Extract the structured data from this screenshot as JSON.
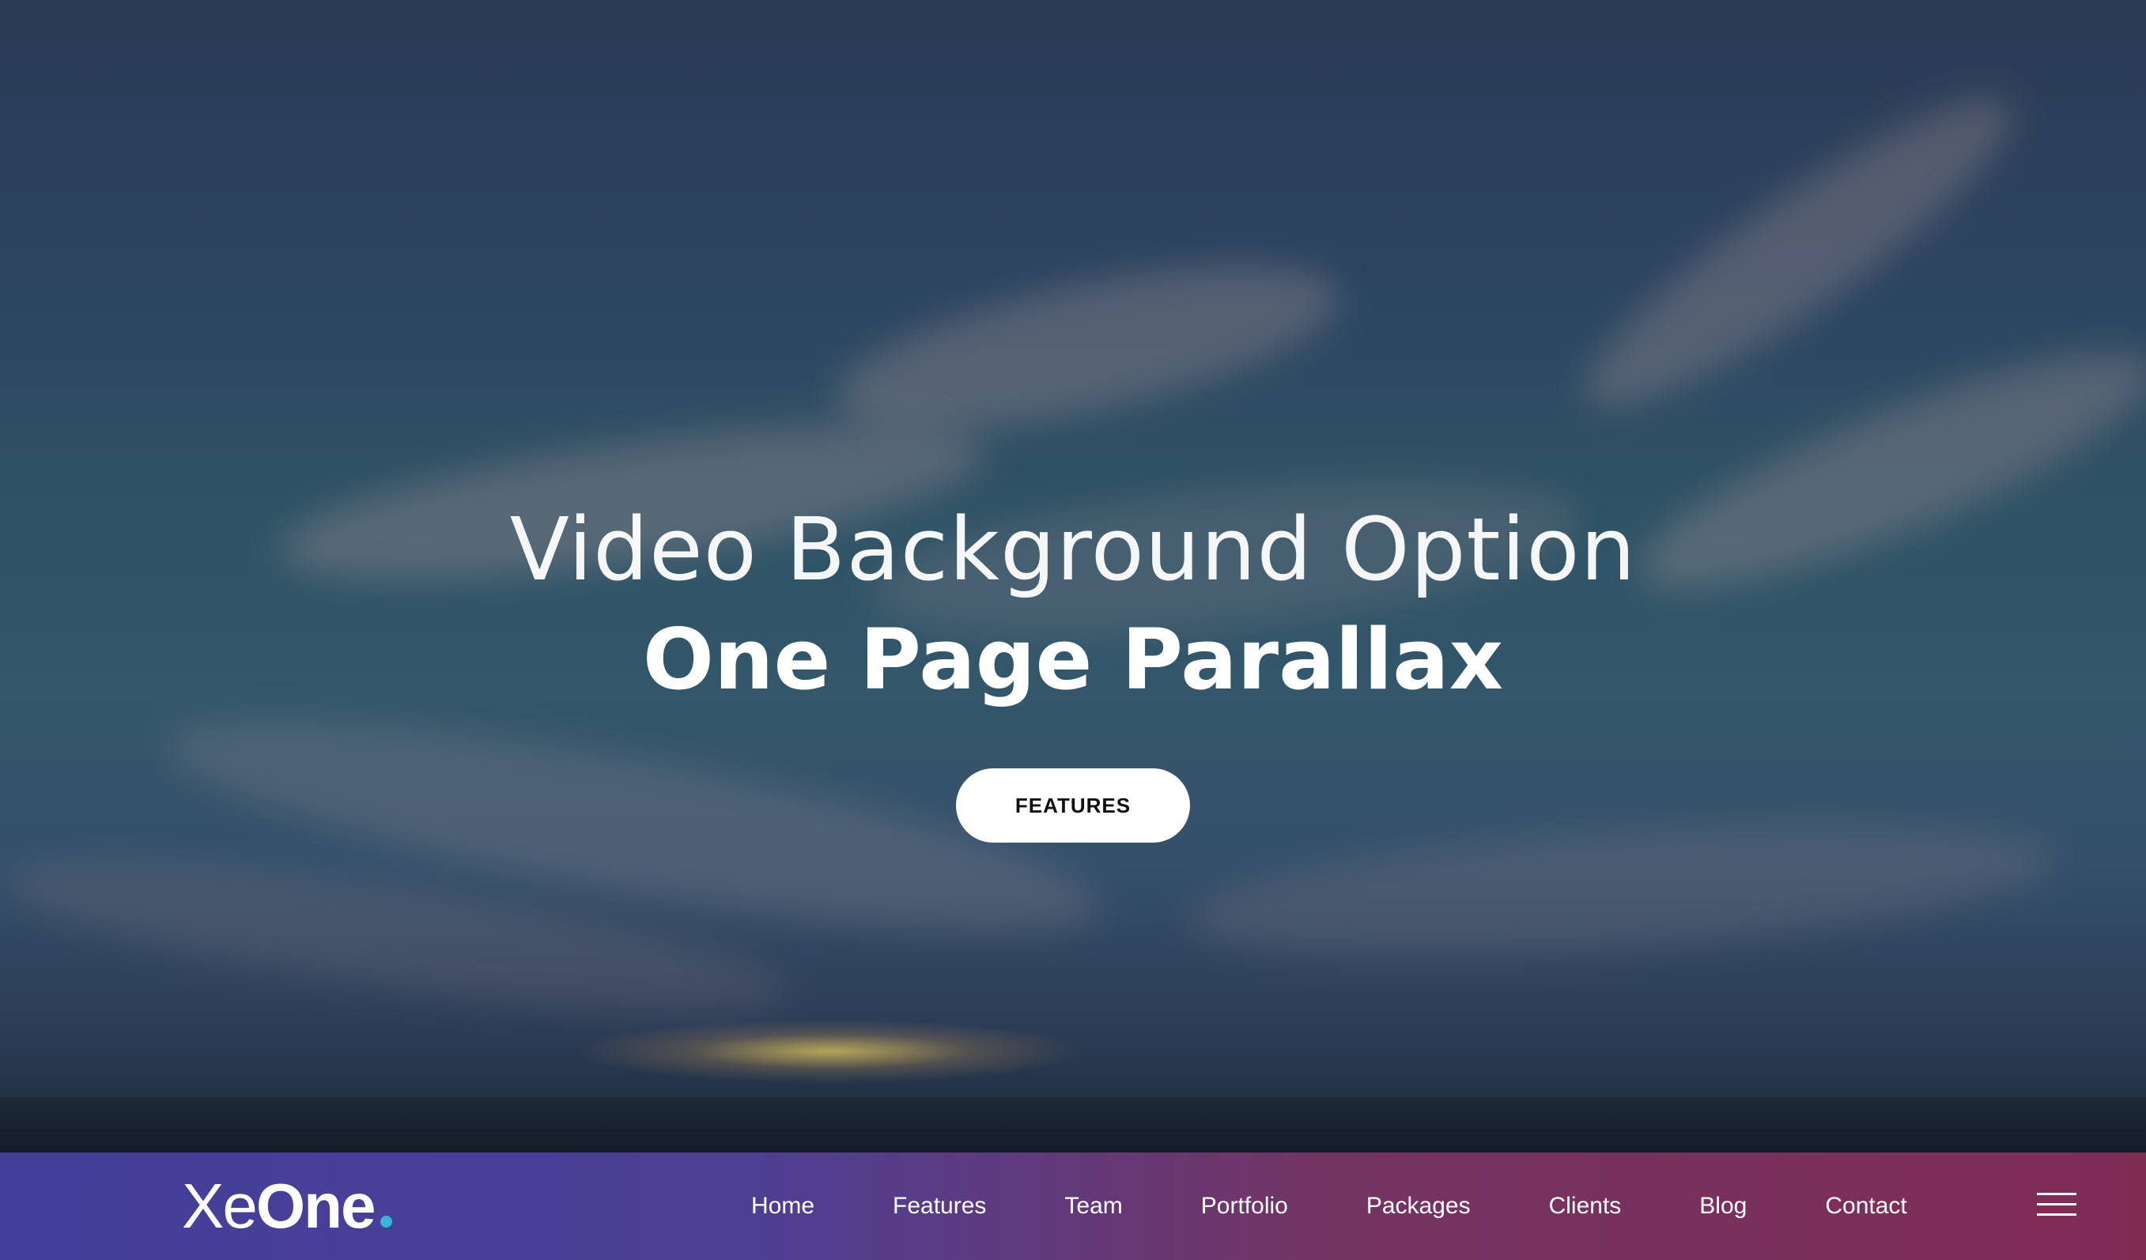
{
  "hero": {
    "subtitle": "Video Background Option",
    "title": "One Page Parallax",
    "cta_label": "FEATURES"
  },
  "navbar": {
    "logo_light": "Xe",
    "logo_bold": "One",
    "items": [
      {
        "label": "Home"
      },
      {
        "label": "Features"
      },
      {
        "label": "Team"
      },
      {
        "label": "Portfolio"
      },
      {
        "label": "Packages"
      },
      {
        "label": "Clients"
      },
      {
        "label": "Blog"
      },
      {
        "label": "Contact"
      }
    ],
    "menu_icon": "hamburger-menu-icon"
  },
  "colors": {
    "nav_gradient_start": "#433f9a",
    "nav_gradient_end": "#7f2c55",
    "logo_dot": "#38b6d8",
    "cta_background": "#ffffff",
    "cta_text": "#111111"
  }
}
